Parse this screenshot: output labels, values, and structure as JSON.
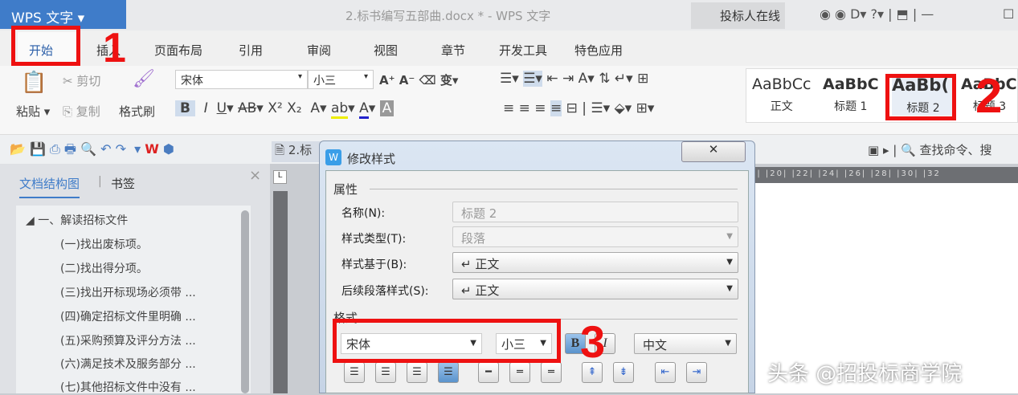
{
  "app": {
    "name": "WPS 文字",
    "doc_title": "2.标书编写五部曲.docx * - WPS 文字",
    "user": "投标人在线"
  },
  "menu": {
    "tabs": [
      "开始",
      "插入",
      "页面布局",
      "引用",
      "审阅",
      "视图",
      "章节",
      "开发工具",
      "特色应用"
    ]
  },
  "ribbon": {
    "paste": "粘贴",
    "cut": "剪切",
    "copy": "复制",
    "format_painter": "格式刷",
    "font": "宋体",
    "size": "小三",
    "styles": [
      {
        "preview": "AaBbCc",
        "label": "正文"
      },
      {
        "preview": "AaBbC",
        "label": "标题 1"
      },
      {
        "preview": "AaBb(",
        "label": "标题 2"
      },
      {
        "preview": "AaBbC",
        "label": "标题 3"
      }
    ],
    "search": "查找命令、搜"
  },
  "quickbar": {
    "doc_tab": "2.标"
  },
  "panel": {
    "tab_outline": "文档结构图",
    "tab_bookmarks": "书签",
    "items": [
      "一、解读招标文件",
      "(一)找出废标项。",
      "(二)找出得分项。",
      "(三)找出开标现场必须带 ...",
      "(四)确定招标文件里明确 ...",
      "(五)采购预算及评分方法 ...",
      "(六)满足技术及服务部分 ...",
      "(七)其他招标文件中没有 ..."
    ]
  },
  "ruler": {
    "marks": "8| |20| |22| |24| |26| |28| |30| |32"
  },
  "dialog": {
    "title": "修改样式",
    "section_props": "属性",
    "name_label": "名称(N):",
    "name_value": "标题 2",
    "type_label": "样式类型(T):",
    "type_value": "段落",
    "based_label": "样式基于(B):",
    "based_value": "↵ 正文",
    "next_label": "后续段落样式(S):",
    "next_value": "↵ 正文",
    "section_format": "格式",
    "font": "宋体",
    "size": "小三",
    "bold": "B",
    "italic": "I",
    "script": "中文"
  },
  "annotations": [
    "1",
    "2",
    "3"
  ],
  "watermark": "头条 @招投标商学院",
  "colors": {
    "accent": "#3f7cc9",
    "annotation": "#ee1111"
  }
}
